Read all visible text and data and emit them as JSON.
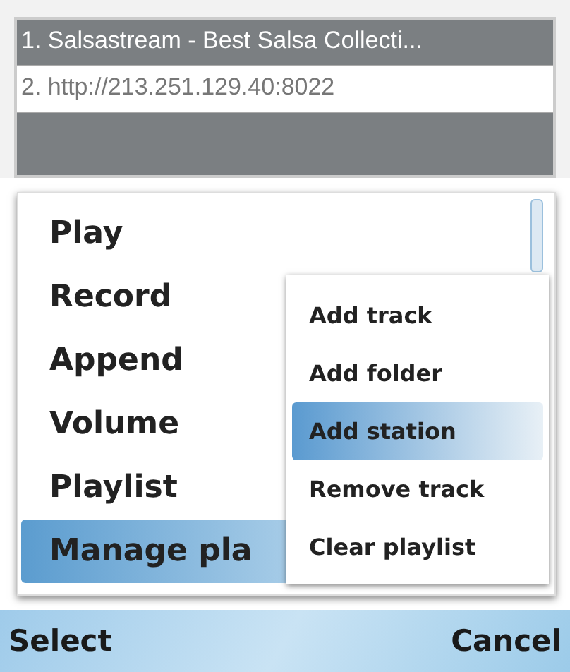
{
  "playlist": {
    "items": [
      {
        "label": "1. Salsastream - Best Salsa Collecti...",
        "selected": false
      },
      {
        "label": "2. http://213.251.129.40:8022",
        "selected": true
      }
    ]
  },
  "menu": {
    "items": [
      {
        "label": "Play",
        "selected": false
      },
      {
        "label": "Record",
        "selected": false
      },
      {
        "label": "Append",
        "selected": false
      },
      {
        "label": "Volume",
        "selected": false
      },
      {
        "label": "Playlist",
        "selected": false
      },
      {
        "label": "Manage pla",
        "selected": true
      }
    ]
  },
  "submenu": {
    "items": [
      {
        "label": "Add track",
        "selected": false
      },
      {
        "label": "Add folder",
        "selected": false
      },
      {
        "label": "Add station",
        "selected": true
      },
      {
        "label": "Remove track",
        "selected": false
      },
      {
        "label": "Clear playlist",
        "selected": false
      }
    ]
  },
  "softkeys": {
    "left": "Select",
    "right": "Cancel"
  }
}
